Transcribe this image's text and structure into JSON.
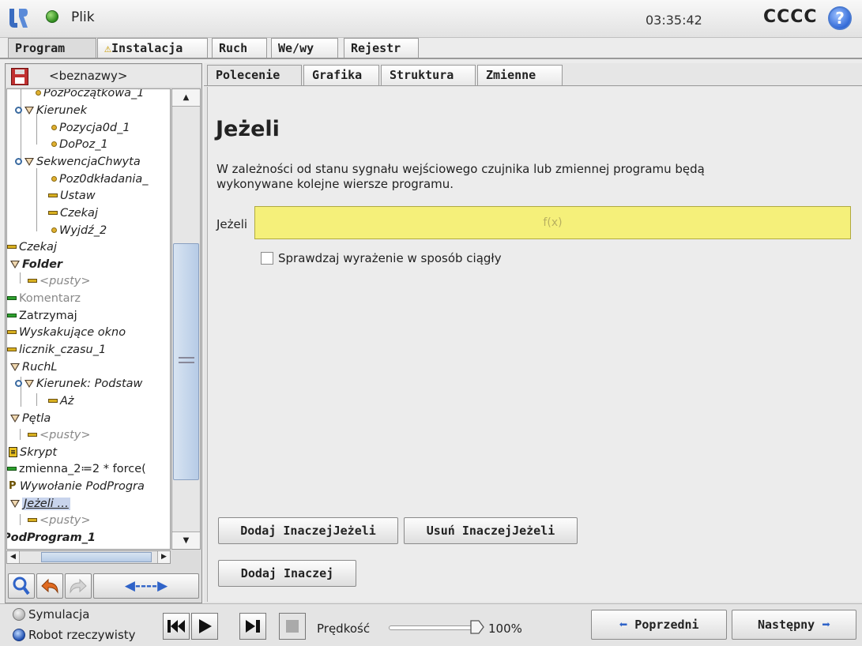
{
  "titlebar": {
    "menu_label": "Plik",
    "time": "03:35:42",
    "robot_name": "CCCC",
    "help_glyph": "?"
  },
  "main_tabs": [
    {
      "label": "Program",
      "active": true
    },
    {
      "label": "Instalacja",
      "warning": true
    },
    {
      "label": "Ruch"
    },
    {
      "label": "We/wy"
    },
    {
      "label": "Rejestr"
    }
  ],
  "left": {
    "program_name": "<beznazwy>",
    "tree": [
      {
        "label": "PozPoczątkowa_1",
        "icon": "waypoint"
      },
      {
        "label": "Kierunek",
        "icon": "folder-open"
      },
      {
        "label": "Pozycja0d_1",
        "icon": "waypoint"
      },
      {
        "label": "DoPoz_1",
        "icon": "waypoint"
      },
      {
        "label": "SekwencjaChwyta",
        "icon": "folder-open"
      },
      {
        "label": "Poz0dkładania_",
        "icon": "waypoint"
      },
      {
        "label": "Ustaw",
        "icon": "bar"
      },
      {
        "label": "Czekaj",
        "icon": "bar"
      },
      {
        "label": "Wyjdź_2",
        "icon": "waypoint"
      },
      {
        "label": "Czekaj",
        "icon": "bar"
      },
      {
        "label": "Folder",
        "icon": "folder"
      },
      {
        "label": "<pusty>",
        "icon": "bar"
      },
      {
        "label": "Komentarz",
        "icon": "bar-green"
      },
      {
        "label": "Zatrzymaj",
        "icon": "bar-green"
      },
      {
        "label": "Wyskakujące okno",
        "icon": "bar"
      },
      {
        "label": "licznik_czasu_1",
        "icon": "bar"
      },
      {
        "label": "RuchL",
        "icon": "folder"
      },
      {
        "label": "Kierunek: Podstaw",
        "icon": "folder-open"
      },
      {
        "label": "Aż",
        "icon": "bar"
      },
      {
        "label": "Pętla",
        "icon": "folder"
      },
      {
        "label": "<pusty>",
        "icon": "bar"
      },
      {
        "label": "Skrypt",
        "icon": "script"
      },
      {
        "label": "zmienna_2≔2 * force(",
        "icon": "bar-green"
      },
      {
        "label": "Wywołanie PodProgra",
        "icon": "subprog"
      },
      {
        "label": "Jeżeli …",
        "icon": "folder"
      },
      {
        "label": "<pusty>",
        "icon": "bar"
      },
      {
        "label": "PodProgram_1",
        "icon": "none"
      }
    ],
    "tool_move_glyph": "◀----▶"
  },
  "sub_tabs": [
    {
      "label": "Polecenie",
      "active": true
    },
    {
      "label": "Grafika"
    },
    {
      "label": "Struktura"
    },
    {
      "label": "Zmienne"
    }
  ],
  "command": {
    "title": "Jeżeli",
    "description_line1": "W zależności od stanu sygnału wejściowego czujnika lub zmiennej programu będą",
    "description_line2": "wykonywane kolejne wiersze programu.",
    "expr_label": "Jeżeli",
    "expr_placeholder": "f(x)",
    "checkbox_label": "Sprawdzaj wyrażenie w sposób ciągły",
    "checkbox_checked": false,
    "btn_add_elseif": "Dodaj InaczejJeżeli",
    "btn_remove_elseif": "Usuń InaczejJeżeli",
    "btn_add_else": "Dodaj Inaczej"
  },
  "footer": {
    "mode_sim": "Symulacja",
    "mode_real": "Robot rzeczywisty",
    "speed_label": "Prędkość",
    "speed_value": "100%",
    "speed_fraction": 1.0,
    "btn_prev": "Poprzedni",
    "btn_next": "Następny"
  },
  "colors": {
    "expr_field": "#f5f07a",
    "accent_blue": "#2f63c8",
    "selection": "#c8d4ec"
  }
}
